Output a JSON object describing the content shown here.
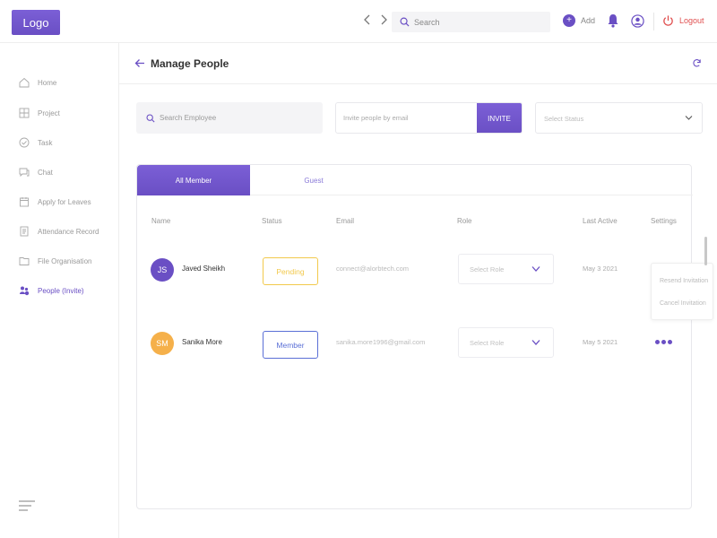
{
  "header": {
    "logo": "Logo",
    "search_placeholder": "Search",
    "add_label": "Add",
    "add_symbol": "+",
    "logout_label": "Logout"
  },
  "sidebar": {
    "items": [
      {
        "label": "Home",
        "icon": "home-icon"
      },
      {
        "label": "Project",
        "icon": "grid-icon"
      },
      {
        "label": "Task",
        "icon": "check-circle-icon"
      },
      {
        "label": "Chat",
        "icon": "chat-icon"
      },
      {
        "label": "Apply for Leaves",
        "icon": "calendar-icon"
      },
      {
        "label": "Attendance Record",
        "icon": "document-icon"
      },
      {
        "label": "File Organisation",
        "icon": "folder-icon"
      },
      {
        "label": "People (Invite)",
        "icon": "people-icon",
        "active": true
      }
    ]
  },
  "main": {
    "title": "Manage People",
    "employee_search_placeholder": "Search Employee",
    "invite_placeholder": "Invite people by email",
    "invite_button": "INVITE",
    "status_select_placeholder": "Select Status",
    "tabs": [
      {
        "label": "All Member",
        "active": true
      },
      {
        "label": "Guest",
        "active": false
      }
    ],
    "columns": [
      "Name",
      "Status",
      "Email",
      "Role",
      "Last Active",
      "Settings"
    ],
    "rows": [
      {
        "initials": "JS",
        "name": "Javed Sheikh",
        "status": "Pending",
        "email": "connect@alorbtech.com",
        "role_placeholder": "Select Role",
        "last_active": "May 3 2021",
        "avatar_color": "#6a4fc4"
      },
      {
        "initials": "SM",
        "name": "Sanika More",
        "status": "Member",
        "email": "sanika.more1996@gmail.com",
        "role_placeholder": "Select Role",
        "last_active": "May 5 2021",
        "avatar_color": "#f5b04a"
      }
    ],
    "settings_menu": [
      "Resend Invitation",
      "Cancel Invitation"
    ]
  },
  "colors": {
    "accent": "#6a4fc4",
    "pending": "#f2c94c",
    "member": "#5a6fd6",
    "logout": "#e05050"
  }
}
